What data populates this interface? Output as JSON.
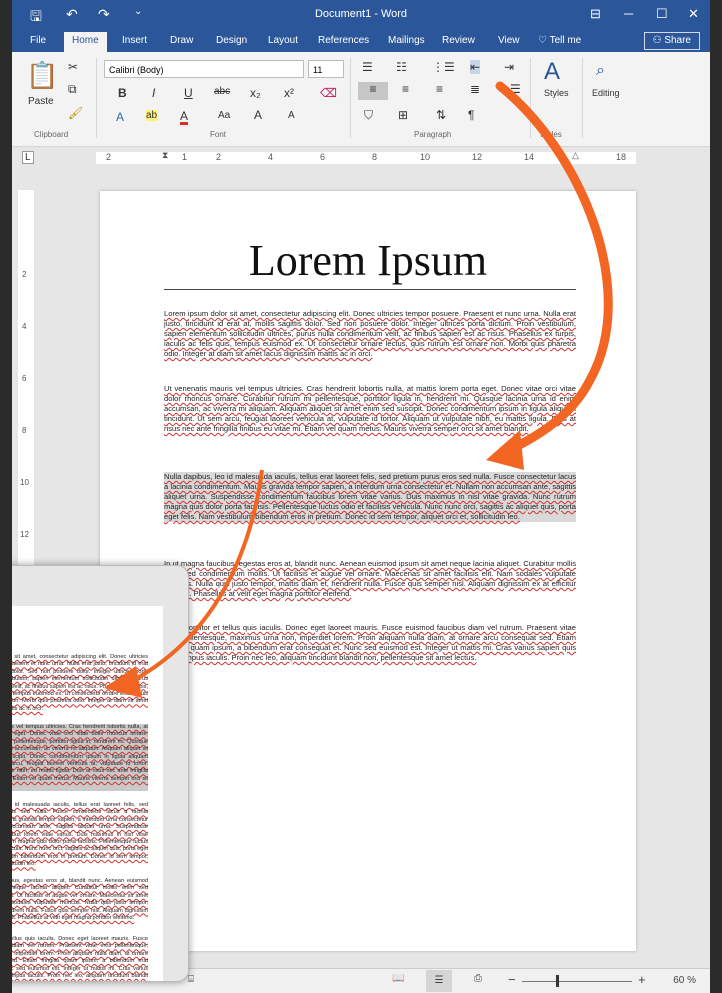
{
  "window_title": "Document1 - Word",
  "quick_access": {
    "save_icon": "save-icon",
    "undo_icon": "undo-icon",
    "redo_icon": "redo-icon",
    "customize": "⌄"
  },
  "window_controls": [
    "⊟",
    "─",
    "☐",
    "✕"
  ],
  "tabs": [
    "File",
    "Home",
    "Insert",
    "Draw",
    "Design",
    "Layout",
    "References",
    "Mailings",
    "Review",
    "View"
  ],
  "tell_me": "Tell me",
  "share": "Share",
  "ribbon": {
    "clipboard": {
      "paste": "Paste",
      "label": "Clipboard"
    },
    "font": {
      "name": "Calibri (Body)",
      "size": "11",
      "label": "Font",
      "buttons": [
        "B",
        "I",
        "U",
        "abc",
        "x₂",
        "x²",
        "A",
        "ab",
        "A",
        "Aa",
        "A",
        "A"
      ]
    },
    "paragraph": {
      "label": "Paragraph"
    },
    "styles": {
      "label": "Styles",
      "button": "Styles"
    },
    "editing": {
      "button": "Editing"
    }
  },
  "ruler": {
    "marks": [
      "2",
      "1",
      "2",
      "4",
      "6",
      "8",
      "10",
      "12",
      "14",
      "18"
    ]
  },
  "vruler": {
    "marks": [
      "2",
      "4",
      "6",
      "8",
      "10",
      "12"
    ]
  },
  "document": {
    "title": "Lorem Ipsum",
    "paragraphs": [
      "Lorem ipsum dolor sit amet, consectetur adipiscing elit. Donec ultricies tempor posuere. Praesent et nunc urna. Nulla erat justo, tincidunt id erat at, mollis sagittis dolor. Sed non posuere dolor. Integer ultrices porta dictum. Proin vestibulum, sapien elementum sollicitudin ultrices, purus nulla condimentum velit, ac finibus sapien est ac risus. Phasellus ex turpis, iaculis ac felis quis, tempus euismod ex. Ut consectetur ornare lectus, quis rutrum est ornare non. Morbi quis pharetra odio. Integer at diam sit amet lacus dignissim mattis ac in orci.",
      "Ut venenatis mauris vel tempus ultricies. Cras hendrerit lobortis nulla, at mattis lorem porta eget. Donec vitae orci vitae dolor rhoncus ornare. Curabitur rutrum mi pellentesque, porttitor ligula in, hendrerit mi. Quisque lacinia urna id enim accumsan, ac viverra mi aliquam. Aliquam aliquet sit amet enim sed suscipit. Donec condimentum ipsum in ligula aliquam tincidunt. Ut sem arcu, feugiat laoreet vehicula at, vulputate id tortor. Aliquam ut vulputate nibh, eu mattis ligula. Duis at risus nec ante fringilla finibus eu vitae mi. Etiam vel quam metus. Mauris viverra semper orci sit amet blandit.",
      "Nulla dapibus, leo id malesuada iaculis, tellus erat laoreet felis, sed pretium purus eros sed nulla. Fusce consectetur lacus a lacinia condimentum. Mauris gravida tempor sapien, a interdum urna consectetur et. Nullam non accumsan ante, sagittis aliquet urna. Suspendisse condimentum faucibus lorem vitae varius. Duis maximus in nisl vitae gravida. Nunc rutrum magna quis dolor porta facilisis. Pellentesque luctus odio et facilisis vehicula. Nunc nunc orci, sagittis ac aliquet quis, porta eget felis. Nam vestibulum bibendum eros in pretium. Donec id sem tempor, aliquet orci et, sollicitudin leo.",
      "In ut magna faucibus, egestas eros at, blandit nunc. Aenean euismod ipsum sit amet neque lacinia aliquet. Curabitur mollis enim sed condimentum mollis. Ut facilisis et augue vel ornare. Maecenas sit amet facilisis elit. Nam sodales vulputate rhoncus. Nulla quis justo tempor, mattis diam et, hendrerit nulla. Fusce quis semper nisl. Aliquam dignissim ex at efficitur suscipit. Phasellus at velit eget magna porttitor eleifend.",
      "Proin porttitor et tellus quis iaculis. Donec eget laoreet mauris. Fusce euismod faucibus diam vel rutrum. Praesent vitae eros pellentesque, maximus urna non, imperdiet lorem. Proin aliquam nulla diam, at ornare arcu consequat sed. Etiam fringilla quam ipsum, a bibendum erat consequat et. Nunc sed euismod est. Integer ut mattis mi. Cras varius sapien quis erat tempus iaculis. Proin nec leo, aliquam tincidunt blandit non, pellentesque sit amet lectus."
    ]
  },
  "inset": {
    "title_fragment": "m"
  },
  "status": {
    "proofing_icon": "proofing-icon",
    "zoom": "60 %",
    "zoom_minus": "−",
    "zoom_plus": "+"
  },
  "colors": {
    "word_blue": "#2b579a",
    "arrow_orange": "#f26522",
    "spell_red": "#d32f2f"
  }
}
